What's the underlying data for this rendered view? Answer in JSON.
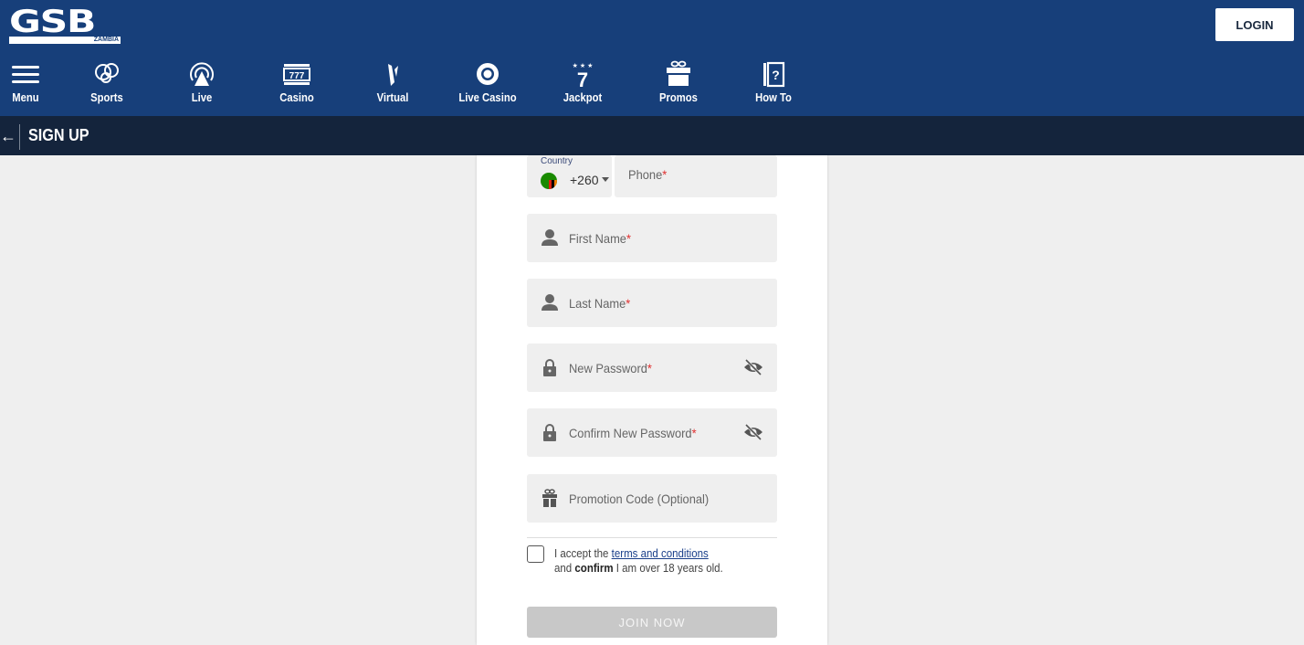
{
  "header": {
    "logo_text": "GSB",
    "logo_sub": "ZAMBIA",
    "login_label": "LOGIN",
    "colors": {
      "primary": "#173f7a",
      "subbar": "#14243c"
    }
  },
  "nav": {
    "items": [
      {
        "label": "Menu",
        "icon": "menu-icon"
      },
      {
        "label": "Sports",
        "icon": "sports-balls-icon"
      },
      {
        "label": "Live",
        "icon": "live-broadcast-icon"
      },
      {
        "label": "Casino",
        "icon": "slot-777-icon"
      },
      {
        "label": "Virtual",
        "icon": "virtual-icon"
      },
      {
        "label": "Live Casino",
        "icon": "casino-chip-icon"
      },
      {
        "label": "Jackpot",
        "icon": "jackpot-seven-icon"
      },
      {
        "label": "Promos",
        "icon": "gift-icon"
      },
      {
        "label": "How To",
        "icon": "help-book-icon"
      }
    ]
  },
  "subbar": {
    "title": "SIGN UP",
    "back_icon": "arrow-left-icon"
  },
  "form": {
    "country_caption": "Country",
    "country_code": "+260",
    "phone_placeholder": "Phone",
    "first_name_placeholder": "First Name",
    "last_name_placeholder": "Last Name",
    "new_password_placeholder": "New Password",
    "confirm_password_placeholder": "Confirm New Password",
    "promo_placeholder": "Promotion Code (Optional)",
    "required_mark": "*",
    "terms_prefix": "I accept the ",
    "terms_link": "terms and conditions",
    "terms_and": "and ",
    "terms_confirm": "confirm",
    "terms_suffix": " I am over 18 years old.",
    "terms_checked": false,
    "join_label": "JOIN NOW",
    "join_enabled": false
  }
}
